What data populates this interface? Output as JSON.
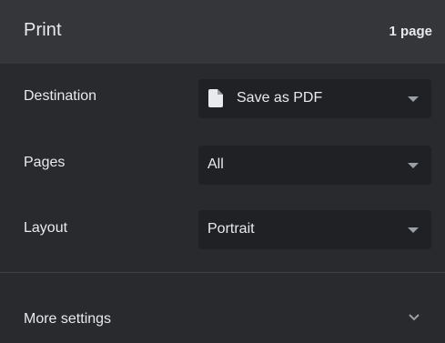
{
  "header": {
    "title": "Print",
    "page_count": "1 page"
  },
  "destination": {
    "label": "Destination",
    "value": "Save as PDF",
    "icon": "document-icon"
  },
  "pages": {
    "label": "Pages",
    "value": "All"
  },
  "layout": {
    "label": "Layout",
    "value": "Portrait"
  },
  "more_settings": {
    "label": "More settings",
    "icon": "chevron-down-icon"
  },
  "colors": {
    "background": "#292a2d",
    "header_background": "#35363a",
    "select_background": "#202124",
    "text": "#e8eaed",
    "caret": "#9aa0a6"
  }
}
